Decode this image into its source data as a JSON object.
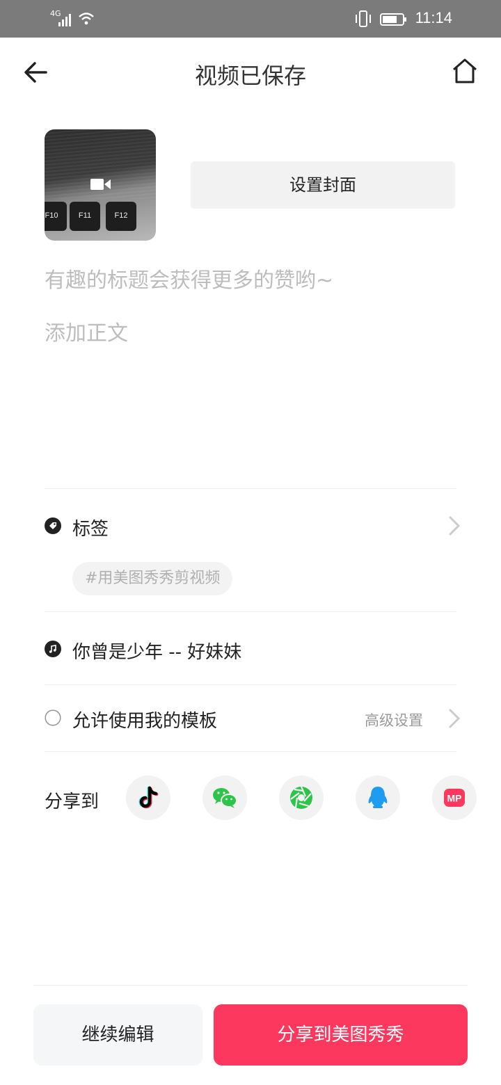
{
  "status_bar": {
    "network": "4G",
    "time": "11:14",
    "icons": [
      "signal-icon",
      "wifi-icon",
      "vibrate-icon",
      "battery-icon"
    ]
  },
  "header": {
    "title": "视频已保存",
    "back_icon": "arrow-left-icon",
    "home_icon": "home-icon"
  },
  "cover": {
    "set_cover_label": "设置封面",
    "thumbnail_icon": "video-camera-icon",
    "key_labels": [
      "F10",
      "F11",
      "F12"
    ]
  },
  "inputs": {
    "title_placeholder": "有趣的标题会获得更多的赞哟~",
    "body_placeholder": "添加正文"
  },
  "tags": {
    "label": "标签",
    "chip": "#用美图秀秀剪视频"
  },
  "music": {
    "label": "你曾是少年 -- 好妹妹"
  },
  "template": {
    "label": "允许使用我的模板",
    "checked": false,
    "advanced_label": "高级设置"
  },
  "share": {
    "label": "分享到",
    "targets": [
      {
        "name": "douyin",
        "icon": "douyin-icon"
      },
      {
        "name": "wechat",
        "icon": "wechat-icon"
      },
      {
        "name": "moments",
        "icon": "wechat-moments-icon"
      },
      {
        "name": "qq",
        "icon": "qq-icon"
      },
      {
        "name": "meipai",
        "icon": "meipai-icon",
        "text": "MP"
      }
    ]
  },
  "footer": {
    "continue_label": "继续编辑",
    "share_label": "分享到美图秀秀"
  },
  "colors": {
    "status_bar_bg": "#7b7b7b",
    "primary": "#fc385e",
    "secondary_button_bg": "#f4f6f8",
    "placeholder": "#bdbdbd",
    "wechat_green": "#2dc44a",
    "qq_blue": "#1e9cf0"
  }
}
